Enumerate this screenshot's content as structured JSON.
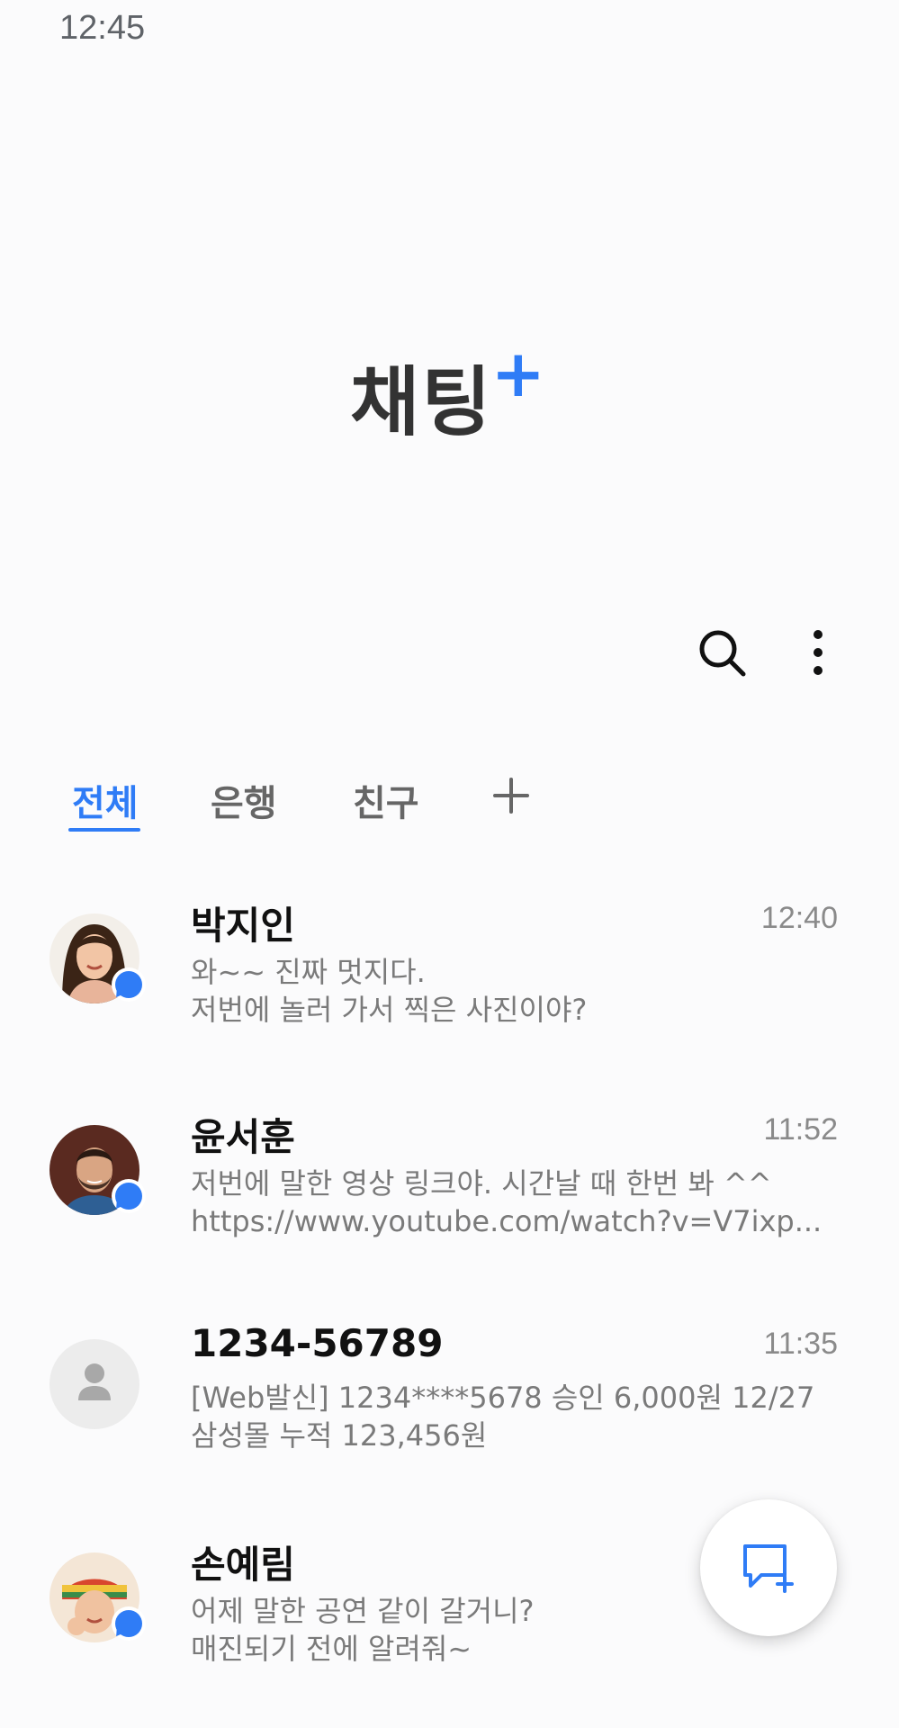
{
  "status_bar": {
    "time": "12:45"
  },
  "app": {
    "title": "채팅",
    "title_plus": "+"
  },
  "toolbar": {
    "search_icon": "search-icon",
    "more_icon": "more-vertical-icon"
  },
  "tabs": [
    {
      "label": "전체",
      "active": true
    },
    {
      "label": "은행",
      "active": false
    },
    {
      "label": "친구",
      "active": false
    }
  ],
  "add_tab_icon": "plus-icon",
  "conversations": [
    {
      "name": "박지인",
      "time": "12:40",
      "lines": [
        "와~~ 진짜 멋지다.",
        "저번에 놀러 가서 찍은 사진이야?"
      ],
      "avatar": "photo",
      "unread": true
    },
    {
      "name": "윤서훈",
      "time": "11:52",
      "lines": [
        "저번에 말한 영상 링크야. 시간날 때 한번 봐 ^^",
        "https://www.youtube.com/watch?v=V7ixp..."
      ],
      "avatar": "photo",
      "unread": true
    },
    {
      "name": "1234-56789",
      "time": "11:35",
      "lines": [
        "[Web발신] 1234****5678 승인 6,000원 12/27",
        "삼성몰 누적 123,456원"
      ],
      "avatar": "placeholder",
      "unread": false
    },
    {
      "name": "손예림",
      "time": "",
      "lines": [
        "어제 말한 공연 같이 갈거니?",
        "매진되기 전에 알려줘~"
      ],
      "avatar": "photo",
      "unread": true
    }
  ],
  "fab": {
    "icon": "new-chat-icon"
  },
  "colors": {
    "accent": "#2f7cf6",
    "background": "#fbfbfc",
    "secondary_text": "#7a7a7a"
  }
}
